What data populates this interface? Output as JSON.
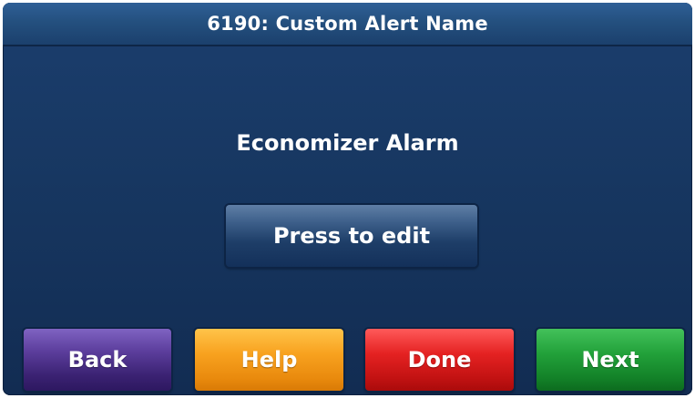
{
  "header": {
    "title": "6190: Custom Alert Name"
  },
  "main": {
    "alert_name": "Economizer Alarm",
    "edit_label": "Press to edit"
  },
  "footer": {
    "back_label": "Back",
    "help_label": "Help",
    "done_label": "Done",
    "next_label": "Next"
  },
  "colors": {
    "background": "#173761",
    "back": "#5d3f9e",
    "help": "#f8a21f",
    "done": "#e52222",
    "next": "#22a13a"
  }
}
